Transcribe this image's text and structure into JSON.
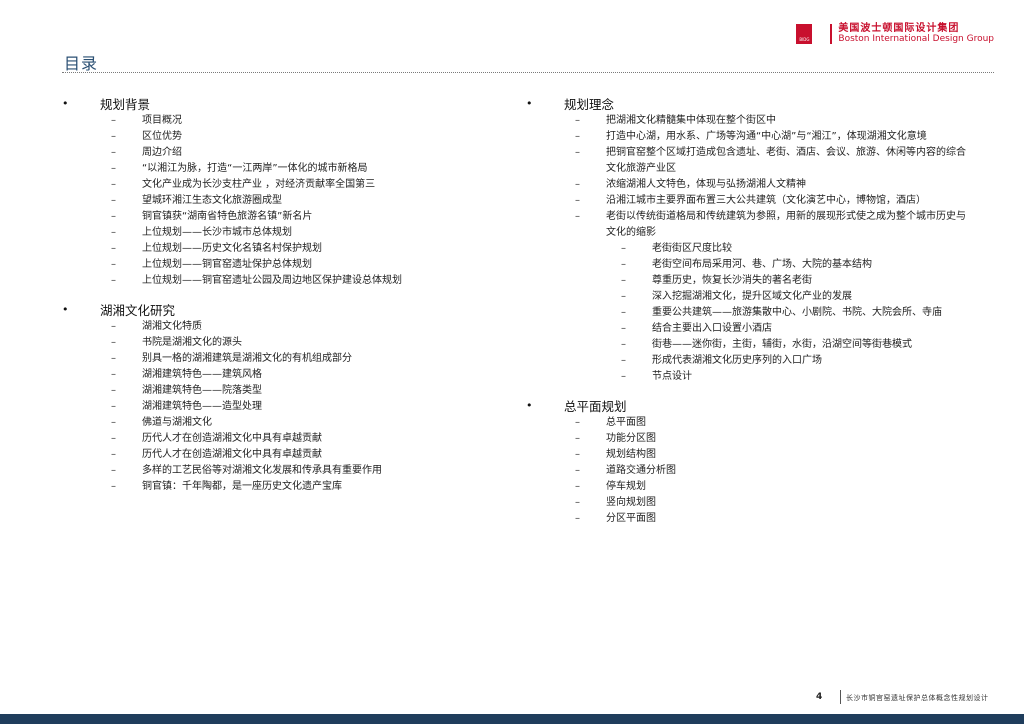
{
  "header": {
    "title": "目录",
    "logo_mark_text": "BIDG",
    "logo_cn": "美国波士顿国际设计集团",
    "logo_en": "Boston International Design Group"
  },
  "left_column": [
    {
      "heading": "规划背景",
      "items": [
        "项目概况",
        "区位优势",
        "周边介绍",
        "“以湘江为脉，打造“一江两岸”一体化的城市新格局",
        "文化产业成为长沙支柱产业 ，对经济贡献率全国第三",
        "望城环湘江生态文化旅游圈成型",
        "铜官镇获“湖南省特色旅游名镇”新名片",
        "上位规划——长沙市城市总体规划",
        "上位规划——历史文化名镇名村保护规划",
        "上位规划——铜官窑遗址保护总体规划",
        "上位规划——铜官窑遗址公园及周边地区保护建设总体规划"
      ]
    },
    {
      "heading": "湖湘文化研究",
      "items": [
        "湖湘文化特质",
        "书院是湖湘文化的源头",
        "别具一格的湖湘建筑是湖湘文化的有机组成部分",
        "湖湘建筑特色——建筑风格",
        "湖湘建筑特色——院落类型",
        "湖湘建筑特色——造型处理",
        "佛道与湖湘文化",
        "历代人才在创造湖湘文化中具有卓越贡献",
        "历代人才在创造湖湘文化中具有卓越贡献",
        "多样的工艺民俗等对湖湘文化发展和传承具有重要作用",
        "铜官镇：千年陶都，是一座历史文化遗产宝库"
      ]
    }
  ],
  "right_column": [
    {
      "heading": "规划理念",
      "items": [
        {
          "text": "把湖湘文化精髓集中体现在整个街区中"
        },
        {
          "text": "打造中心湖，用水系、广场等沟通“中心湖”与“湘江”，体现湖湘文化意境"
        },
        {
          "text": "把铜官窑整个区域打造成包含遗址、老街、酒店、会议、旅游、休闲等内容的综合文化旅游产业区"
        },
        {
          "text": "浓缩湖湘人文特色，体现与弘扬湖湘人文精神"
        },
        {
          "text": "沿湘江城市主要界面布置三大公共建筑（文化演艺中心，博物馆，酒店）"
        },
        {
          "text": "老街以传统街道格局和传统建筑为参照，用新的展现形式使之成为整个城市历史与文化的缩影",
          "sub": [
            "老街街区尺度比较",
            "老街空间布局采用河、巷、广场、大院的基本结构",
            "尊重历史，恢复长沙消失的著名老街",
            "深入挖掘湖湘文化，提升区域文化产业的发展",
            "重要公共建筑——旅游集散中心、小剧院、书院、大院会所、寺庙",
            "结合主要出入口设置小酒店",
            "街巷——迷你街，主街，辅街，水街，沿湖空间等街巷模式",
            "形成代表湖湘文化历史序列的入口广场",
            "节点设计"
          ]
        }
      ]
    },
    {
      "heading": "总平面规划",
      "items": [
        {
          "text": "总平面图"
        },
        {
          "text": "功能分区图"
        },
        {
          "text": "规划结构图"
        },
        {
          "text": "道路交通分析图"
        },
        {
          "text": "停车规划"
        },
        {
          "text": "竖向规划图"
        },
        {
          "text": "分区平面图"
        }
      ]
    }
  ],
  "footer": {
    "page_number": "4",
    "document_title": "长沙市铜官窑遗址保护总体概念性规划设计"
  },
  "symbols": {
    "bullet": "•",
    "dash": "–"
  },
  "colors": {
    "title": "#2a4f73",
    "brand_red": "#c8102e",
    "bottom_bar": "#1f3d5c"
  }
}
